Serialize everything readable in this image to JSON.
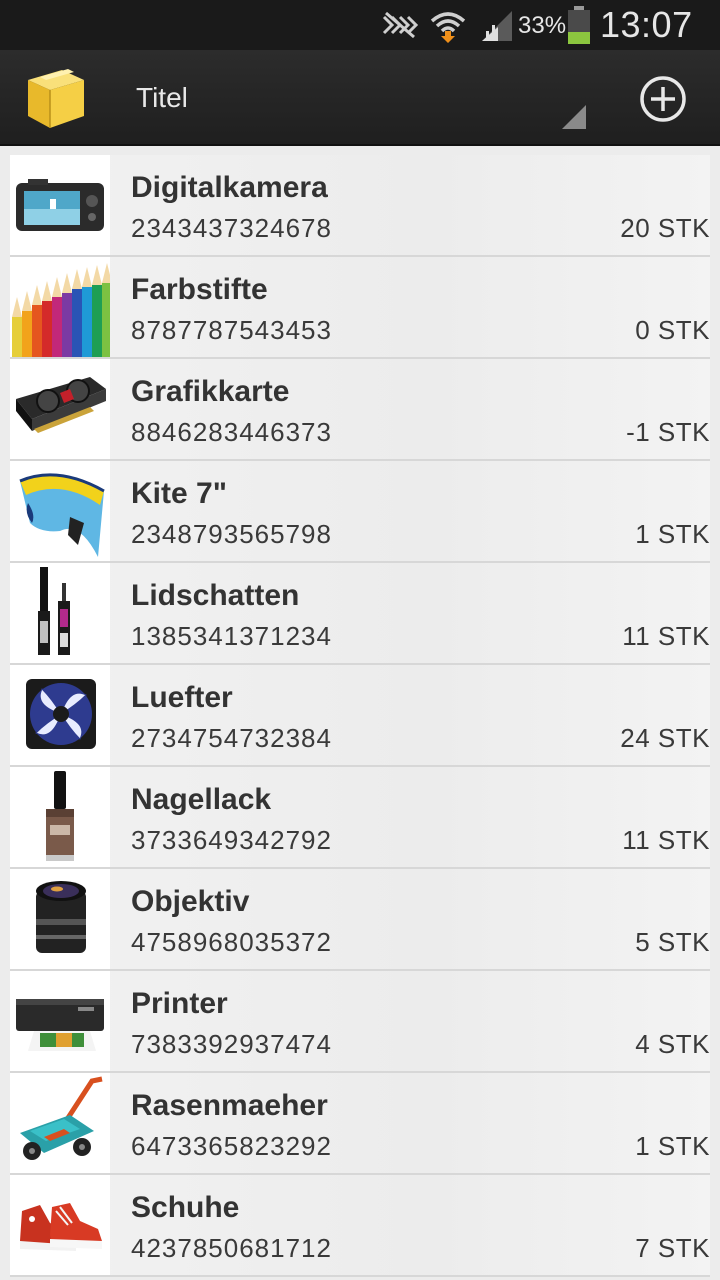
{
  "status_bar": {
    "battery_percent": "33%",
    "time": "13:07",
    "icons": [
      "nfc-off-icon",
      "wifi-download-icon",
      "signal-icon",
      "battery-icon"
    ]
  },
  "action_bar": {
    "logo_icon": "box-icon",
    "title": "Titel",
    "add_icon": "add-circle-icon"
  },
  "colors": {
    "action_bar": "#222222",
    "status_bar": "#1a1a1a",
    "list_background": "#ececec",
    "battery_fill": "#8cc63f"
  },
  "items": [
    {
      "name": "Digitalkamera",
      "code": "2343437324678",
      "qty": "20 STK",
      "icon": "camera-icon"
    },
    {
      "name": "Farbstifte",
      "code": "8787787543453",
      "qty": "0 STK",
      "icon": "colored-pencils-icon"
    },
    {
      "name": "Grafikkarte",
      "code": "8846283446373",
      "qty": "-1 STK",
      "icon": "graphics-card-icon"
    },
    {
      "name": "Kite 7\"",
      "code": "2348793565798",
      "qty": "1 STK",
      "icon": "kite-icon"
    },
    {
      "name": "Lidschatten",
      "code": "1385341371234",
      "qty": "11 STK",
      "icon": "mascara-icon"
    },
    {
      "name": "Luefter",
      "code": "2734754732384",
      "qty": "24 STK",
      "icon": "fan-icon"
    },
    {
      "name": "Nagellack",
      "code": "3733649342792",
      "qty": "11 STK",
      "icon": "nail-polish-icon"
    },
    {
      "name": "Objektiv",
      "code": "4758968035372",
      "qty": "5 STK",
      "icon": "lens-icon"
    },
    {
      "name": "Printer",
      "code": "7383392937474",
      "qty": "4 STK",
      "icon": "printer-icon"
    },
    {
      "name": "Rasenmaeher",
      "code": "6473365823292",
      "qty": "1 STK",
      "icon": "lawn-mower-icon"
    },
    {
      "name": "Schuhe",
      "code": "4237850681712",
      "qty": "7 STK",
      "icon": "shoes-icon"
    }
  ]
}
